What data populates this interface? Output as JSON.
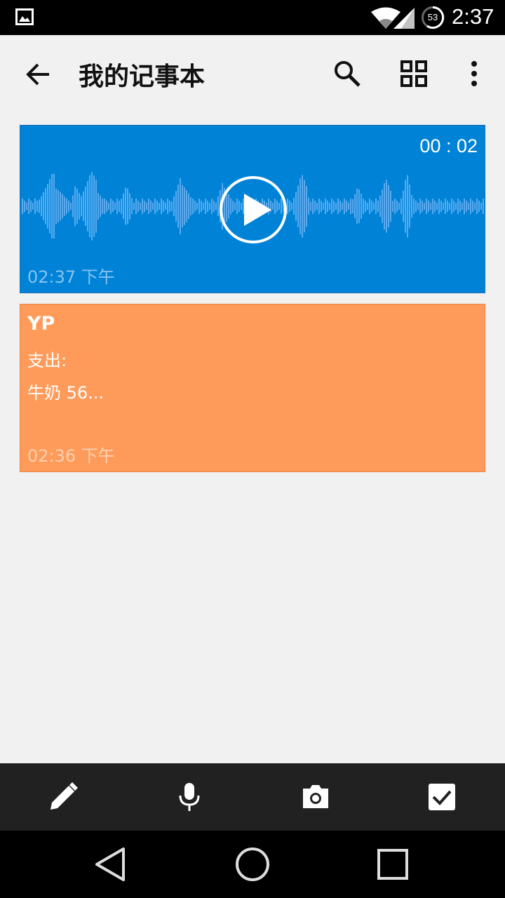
{
  "status_bar": {
    "battery_level": "53",
    "time": "2:37",
    "icons": [
      "gallery-icon",
      "wifi-icon",
      "cellular-icon",
      "battery-icon"
    ]
  },
  "toolbar": {
    "title": "我的记事本",
    "icons": [
      "back-arrow-icon",
      "search-icon",
      "grid-view-icon",
      "more-vert-icon"
    ]
  },
  "notes": [
    {
      "type": "voice",
      "duration": "00 : 02",
      "time": "02:37 下午",
      "color": "#0083d6"
    },
    {
      "type": "text",
      "title": "YP",
      "lines": [
        "支出:",
        "牛奶 56..."
      ],
      "time": "02:36 下午",
      "color": "#ff9b5a"
    }
  ],
  "bottom_bar": {
    "icons": [
      "pencil-icon",
      "microphone-icon",
      "camera-icon",
      "checkbox-icon"
    ]
  },
  "nav_bar": {
    "icons": [
      "nav-back-icon",
      "nav-home-icon",
      "nav-recents-icon"
    ]
  },
  "colors": {
    "background": "#f1f1f1",
    "voice_card": "#0083d6",
    "text_card": "#ff9b5a",
    "bottom_bar": "#212121"
  }
}
